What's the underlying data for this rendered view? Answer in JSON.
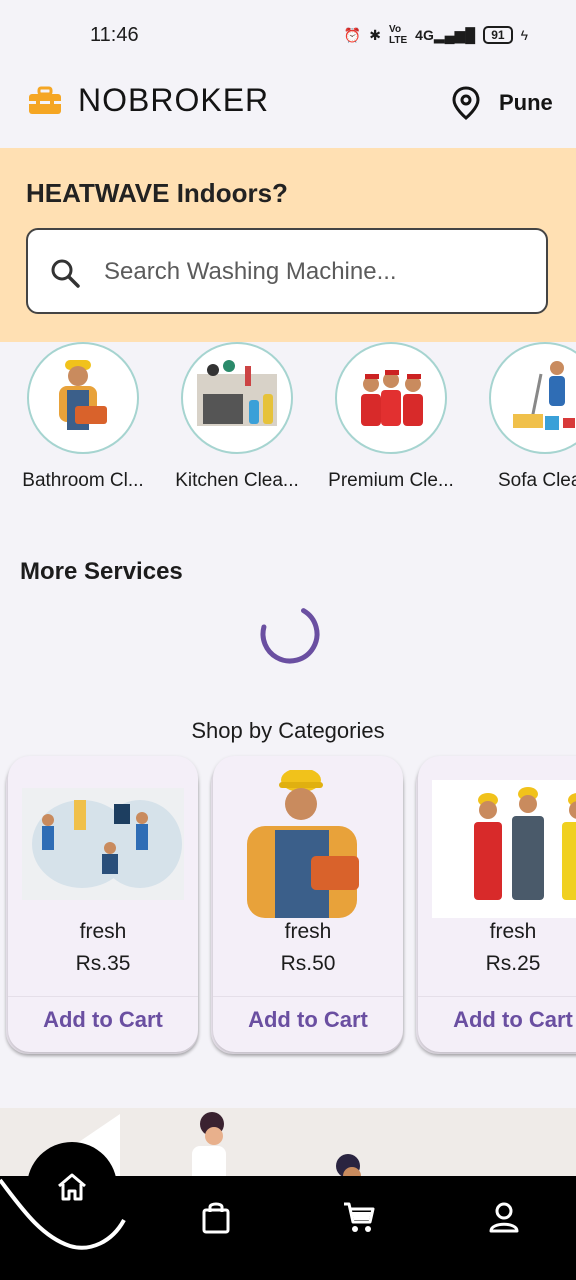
{
  "status": {
    "time": "11:46",
    "battery": "91"
  },
  "app": {
    "title": "NOBROKER",
    "location": "Pune"
  },
  "hero": {
    "title": "HEATWAVE Indoors?",
    "search_placeholder": "Search Washing Machine..."
  },
  "categories": [
    {
      "label": "Bathroom Cl..."
    },
    {
      "label": "Kitchen Clea..."
    },
    {
      "label": "Premium Cle..."
    },
    {
      "label": "Sofa Clean"
    }
  ],
  "sections": {
    "more_services": "More Services",
    "shop_by_categories": "Shop by Categories"
  },
  "products": [
    {
      "name": "fresh",
      "price": "Rs.35",
      "button": "Add to Cart"
    },
    {
      "name": "fresh",
      "price": "Rs.50",
      "button": "Add to Cart"
    },
    {
      "name": "fresh",
      "price": "Rs.25",
      "button": "Add to Cart"
    }
  ],
  "nav": {
    "items": [
      "home-icon",
      "bag-icon",
      "cart-icon",
      "profile-icon"
    ]
  },
  "colors": {
    "hero_bg": "#ffe0b3",
    "accent": "#6a4fa1",
    "spinner": "#6a4fa1",
    "brand_orange": "#f5a623"
  }
}
